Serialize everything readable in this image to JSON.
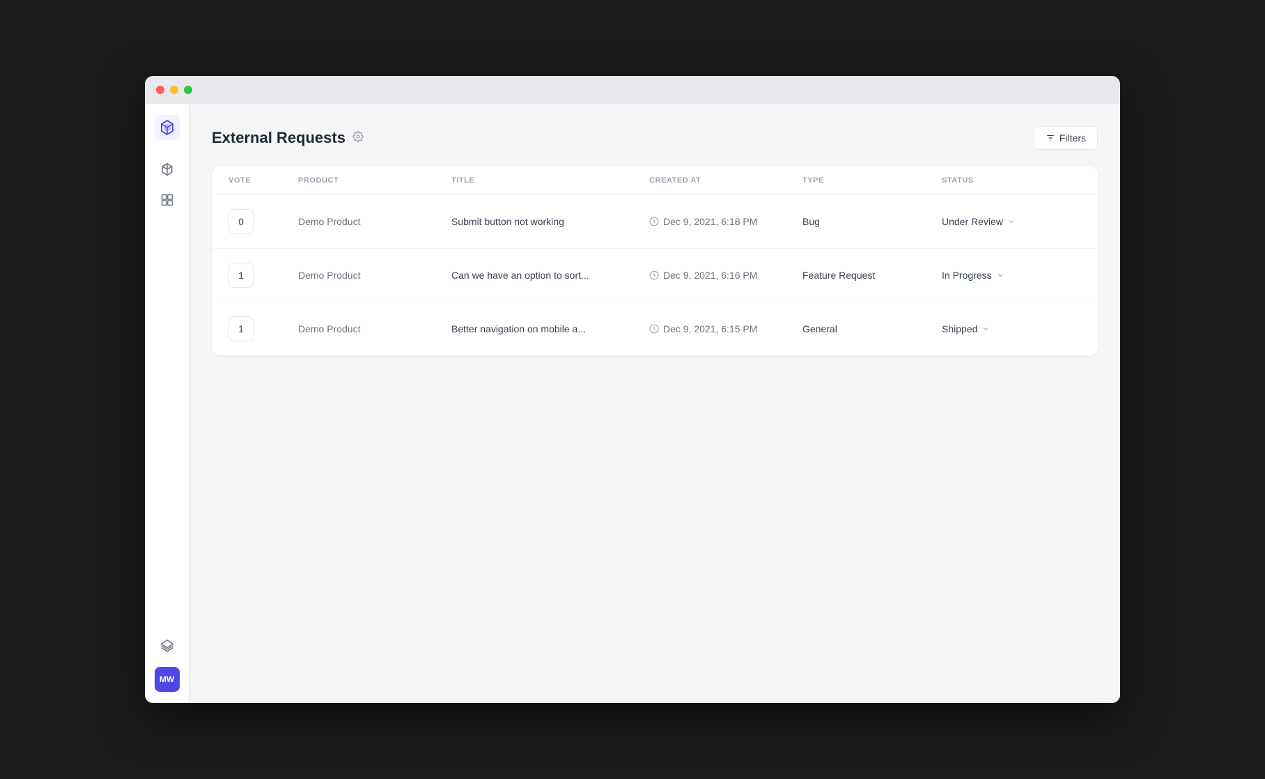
{
  "window": {
    "title": "External Requests"
  },
  "sidebar": {
    "logo_text": "MW",
    "icons": [
      {
        "name": "cube-icon",
        "symbol": "⬡"
      },
      {
        "name": "layout-icon",
        "symbol": "⊞"
      }
    ],
    "bottom_icons": [
      {
        "name": "layers-icon",
        "symbol": "◫"
      }
    ],
    "user": {
      "initials": "MW",
      "color": "#4f46e5"
    }
  },
  "page": {
    "title": "External Requests",
    "filters_label": "Filters"
  },
  "table": {
    "columns": [
      {
        "key": "vote",
        "label": "VOTE"
      },
      {
        "key": "product",
        "label": "PRODUCT"
      },
      {
        "key": "title",
        "label": "TITLE"
      },
      {
        "key": "created_at",
        "label": "CREATED AT"
      },
      {
        "key": "type",
        "label": "TYPE"
      },
      {
        "key": "status",
        "label": "STATUS"
      }
    ],
    "rows": [
      {
        "vote": "0",
        "product": "Demo Product",
        "title": "Submit button not working",
        "created_at": "Dec 9, 2021, 6:18 PM",
        "type": "Bug",
        "status": "Under Review"
      },
      {
        "vote": "1",
        "product": "Demo Product",
        "title": "Can we have an option to sort...",
        "created_at": "Dec 9, 2021, 6:16 PM",
        "type": "Feature Request",
        "status": "In Progress"
      },
      {
        "vote": "1",
        "product": "Demo Product",
        "title": "Better navigation on mobile a...",
        "created_at": "Dec 9, 2021, 6:15 PM",
        "type": "General",
        "status": "Shipped"
      }
    ]
  }
}
